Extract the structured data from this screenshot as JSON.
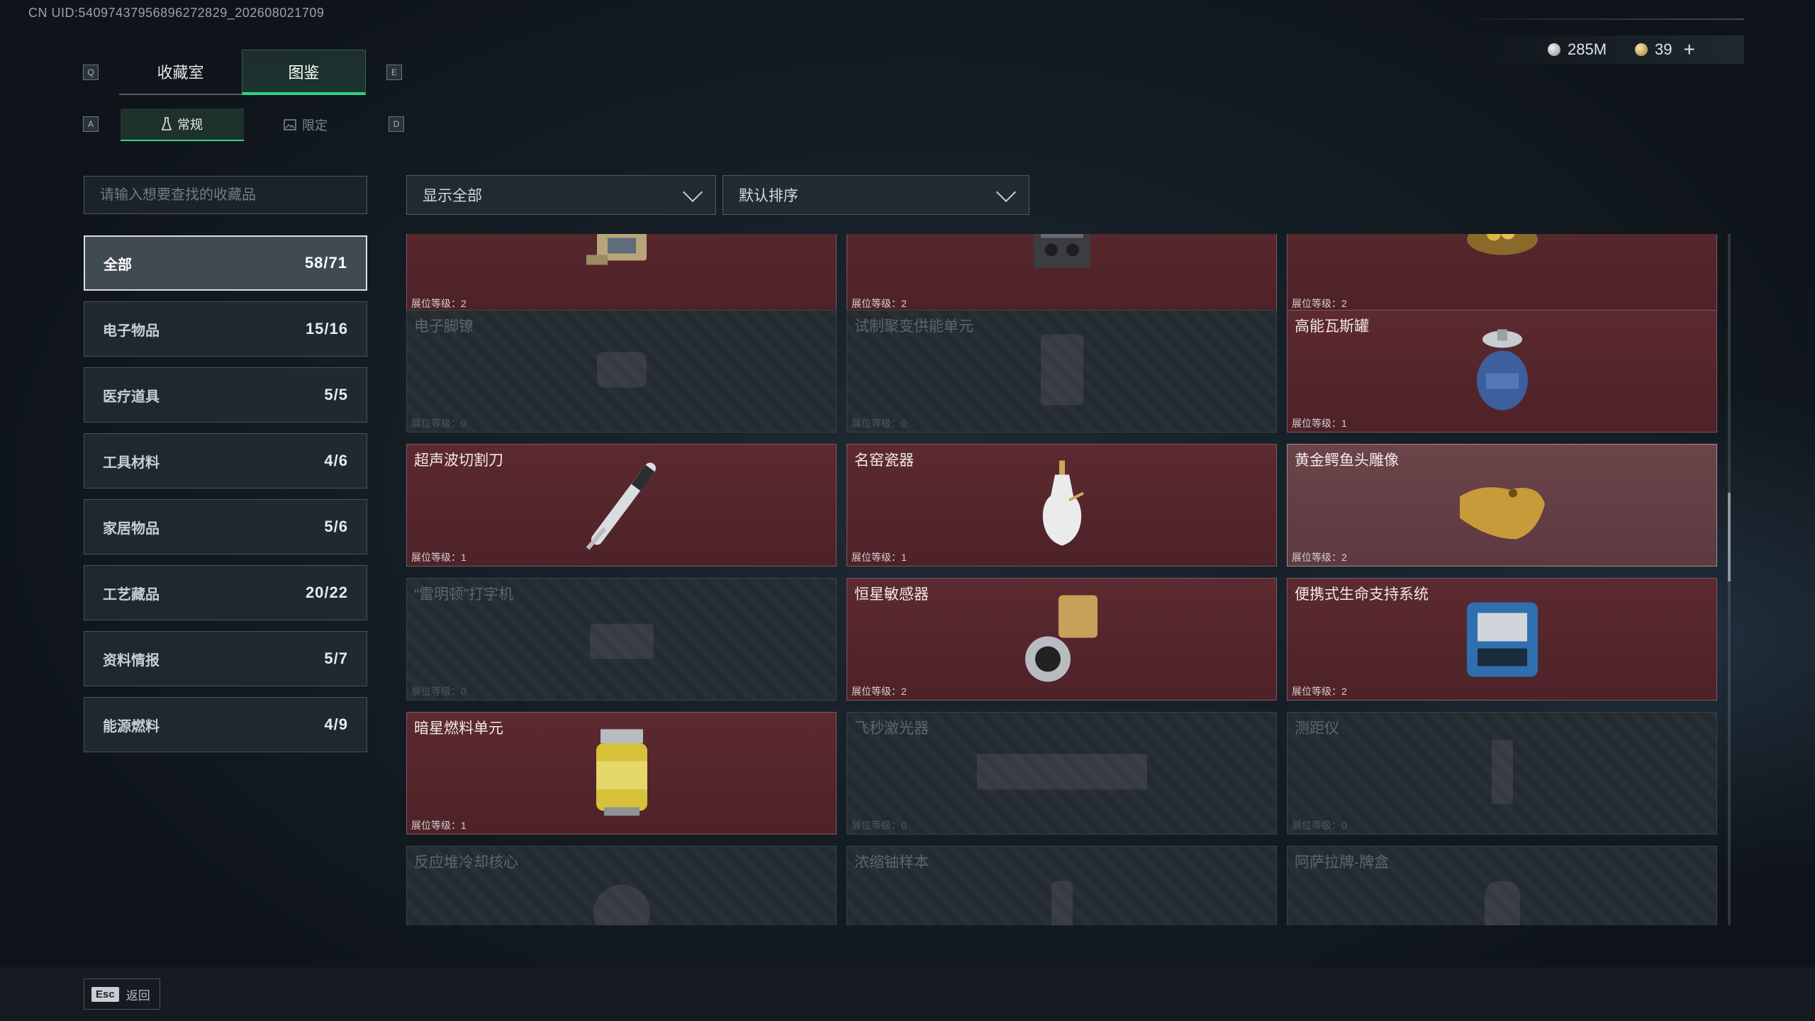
{
  "header": {
    "uid": "CN UID:54097437956896272829_202608021709",
    "currency": [
      {
        "icon": "silver-coin-icon",
        "value": "285M"
      },
      {
        "icon": "gold-coin-icon",
        "value": "39"
      }
    ],
    "add_label": "+"
  },
  "tabs": {
    "key_left": "Q",
    "key_right": "E",
    "items": [
      {
        "label": "收藏室",
        "active": false
      },
      {
        "label": "图鉴",
        "active": true
      }
    ]
  },
  "subtabs": {
    "key_left": "A",
    "key_right": "D",
    "items": [
      {
        "label": "常规",
        "icon": "flask-icon",
        "active": true
      },
      {
        "label": "限定",
        "icon": "image-icon",
        "active": false
      }
    ]
  },
  "search": {
    "placeholder": "请输入想要查找的收藏品"
  },
  "categories": [
    {
      "name": "全部",
      "count": "58/71",
      "active": true
    },
    {
      "name": "电子物品",
      "count": "15/16"
    },
    {
      "name": "医疗道具",
      "count": "5/5"
    },
    {
      "name": "工具材料",
      "count": "4/6"
    },
    {
      "name": "家居物品",
      "count": "5/6"
    },
    {
      "name": "工艺藏品",
      "count": "20/22"
    },
    {
      "name": "资料情报",
      "count": "5/7"
    },
    {
      "name": "能源燃料",
      "count": "4/9"
    }
  ],
  "filters": {
    "show": "显示全部",
    "sort": "默认排序"
  },
  "items": [
    {
      "title": "",
      "level": "展位等级：2",
      "owned": true,
      "icon": "device-icon"
    },
    {
      "title": "",
      "level": "展位等级：2",
      "owned": true,
      "icon": "radio-icon"
    },
    {
      "title": "",
      "level": "展位等级：2",
      "owned": true,
      "icon": "golden-nest-icon"
    },
    {
      "title": "电子脚镣",
      "level": "展位等级：0",
      "owned": false,
      "icon": "ankle-monitor-icon"
    },
    {
      "title": "试制聚变供能单元",
      "level": "展位等级：0",
      "owned": false,
      "icon": "fusion-unit-icon"
    },
    {
      "title": "高能瓦斯罐",
      "level": "展位等级：1",
      "owned": true,
      "icon": "gas-canister-icon"
    },
    {
      "title": "超声波切割刀",
      "level": "展位等级：1",
      "owned": true,
      "icon": "ultrasonic-knife-icon"
    },
    {
      "title": "名窑瓷器",
      "level": "展位等级：1",
      "owned": true,
      "icon": "porcelain-vase-icon"
    },
    {
      "title": "黄金鳄鱼头雕像",
      "level": "展位等级：2",
      "owned": true,
      "icon": "gold-crocodile-icon",
      "highlight": true
    },
    {
      "title": "“雷明顿”打字机",
      "level": "展位等级：0",
      "owned": false,
      "icon": "typewriter-icon"
    },
    {
      "title": "恒星敏感器",
      "level": "展位等级：2",
      "owned": true,
      "icon": "star-sensor-icon"
    },
    {
      "title": "便携式生命支持系统",
      "level": "展位等级：2",
      "owned": true,
      "icon": "life-support-icon"
    },
    {
      "title": "暗星燃料单元",
      "level": "展位等级：1",
      "owned": true,
      "icon": "fuel-cell-icon"
    },
    {
      "title": "飞秒激光器",
      "level": "展位等级：0",
      "owned": false,
      "icon": "laser-icon"
    },
    {
      "title": "测距仪",
      "level": "展位等级：0",
      "owned": false,
      "icon": "rangefinder-icon"
    },
    {
      "title": "反应堆冷却核心",
      "level": "",
      "owned": false,
      "icon": "reactor-core-icon"
    },
    {
      "title": "浓缩铀样本",
      "level": "",
      "owned": false,
      "icon": "uranium-sample-icon"
    },
    {
      "title": "阿萨拉牌-牌盒",
      "level": "",
      "owned": false,
      "icon": "card-box-icon"
    }
  ],
  "footer": {
    "key": "Esc",
    "label": "返回"
  }
}
